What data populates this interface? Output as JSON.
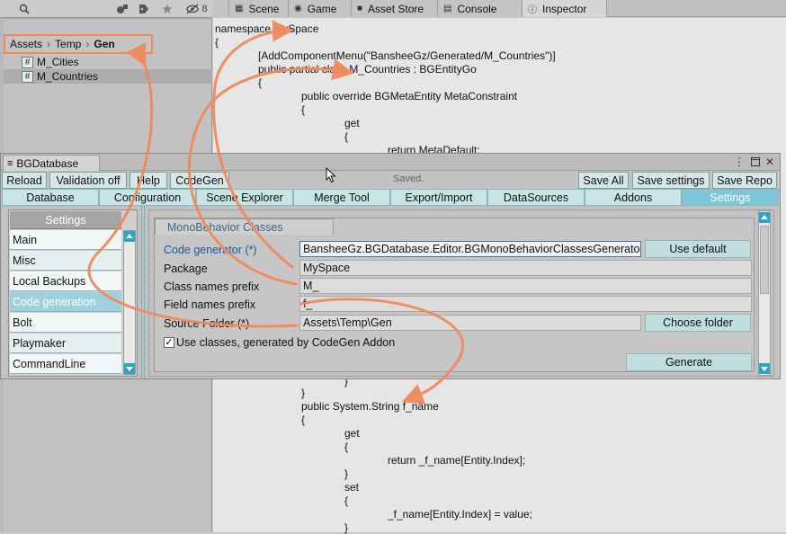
{
  "project": {
    "toolbar_count": "8",
    "breadcrumb": [
      "Assets",
      "Temp",
      "Gen"
    ],
    "files": [
      {
        "name": "M_Cities",
        "selected": false
      },
      {
        "name": "M_Countries",
        "selected": true
      }
    ]
  },
  "editor_tabs": [
    {
      "label": "Scene",
      "icon": "scene-icon"
    },
    {
      "label": "Game",
      "icon": "game-icon"
    },
    {
      "label": "Asset Store",
      "icon": "store-icon"
    },
    {
      "label": "Console",
      "icon": "console-icon"
    },
    {
      "label": "Inspector",
      "icon": "info-icon",
      "active": true
    }
  ],
  "code_top": [
    "namespace MySpace",
    "{",
    "[AddComponentMenu(\"BansheeGz/Generated/M_Countries\")]",
    "public partial class M_Countries : BGEntityGo",
    "{",
    "public override BGMetaEntity MetaConstraint",
    "{",
    "get",
    "{",
    "return MetaDefault;"
  ],
  "code_bottom": [
    "}",
    "}",
    "public System.String f_name",
    "{",
    "get",
    "{",
    "return _f_name[Entity.Index];",
    "}",
    "set",
    "{",
    "_f_name[Entity.Index] = value;",
    "}"
  ],
  "code_edge_char": "e",
  "bgdb": {
    "window_title": "BGDatabase",
    "toolbar_left": [
      "Reload",
      "Validation off",
      "Help",
      "CodeGen"
    ],
    "status": "Saved.",
    "toolbar_right": [
      "Save All",
      "Save settings",
      "Save Repo"
    ],
    "main_tabs": [
      "Database",
      "Configuration",
      "Scene Explorer",
      "Merge Tool",
      "Export/Import",
      "DataSources",
      "Addons",
      "Settings"
    ],
    "active_main_tab": "Settings",
    "settings_header": "Settings",
    "settings_items": [
      "Main",
      "Misc",
      "Local Backups",
      "Code generation",
      "Bolt",
      "Playmaker",
      "CommandLine"
    ],
    "active_settings_item": "Code generation",
    "group_title": "MonoBehavior Classes",
    "fields": {
      "code_generator_label": "Code generator (*)",
      "code_generator_value": "BansheeGz.BGDatabase.Editor.BGMonoBehaviorClassesGenerator",
      "use_default": "Use default",
      "package_label": "Package",
      "package_value": "MySpace",
      "class_prefix_label": "Class names prefix",
      "class_prefix_value": "M_",
      "field_prefix_label": "Field names prefix",
      "field_prefix_value": "f_",
      "source_folder_label": "Source Folder (*)",
      "source_folder_value": "Assets\\Temp\\Gen",
      "choose_folder": "Choose folder",
      "use_classes_label": "Use classes, generated by CodeGen Addon",
      "use_classes_checked": true,
      "generate": "Generate"
    }
  },
  "colors": {
    "accent_teal": "#28a7c6",
    "arrow": "#f08a5d",
    "active_tab": "#7dc6d8"
  }
}
